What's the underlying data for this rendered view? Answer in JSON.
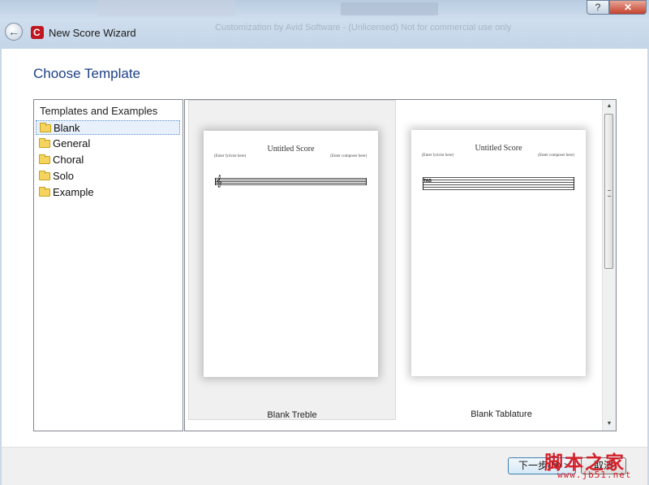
{
  "window": {
    "title": "New Score Wizard",
    "background_text": "Customization by Avid Software - (Unlicensed) Not for commercial use only",
    "help_button": "?",
    "close_button": "✕",
    "back_button": "←",
    "app_icon": "finale-logo-icon",
    "app_icon_glyph": "C"
  },
  "heading": "Choose Template",
  "templates_panel": {
    "title": "Templates and Examples",
    "items": [
      {
        "label": "Blank",
        "selected": true
      },
      {
        "label": "General",
        "selected": false
      },
      {
        "label": "Choral",
        "selected": false
      },
      {
        "label": "Solo",
        "selected": false
      },
      {
        "label": "Example",
        "selected": false
      }
    ]
  },
  "previews": [
    {
      "label": "Blank Treble",
      "selected": true,
      "page": {
        "title": "Untitled Score",
        "lyricist": "(Enter lyricist here)",
        "composer": "(Enter composer here)",
        "clef": "𝄞",
        "clef_type": "treble"
      }
    },
    {
      "label": "Blank Tablature",
      "selected": false,
      "page": {
        "title": "Untitled Score",
        "lyricist": "(Enter lyricist here)",
        "composer": "(Enter composer here)",
        "clef": "TAB",
        "clef_type": "tab"
      }
    }
  ],
  "scrollbar": {
    "up": "▲",
    "down": "▼"
  },
  "footer": {
    "next_label": "下一步(N) >",
    "cancel_label": "取消"
  },
  "watermark": {
    "text_cn": "脚本之家",
    "url": "www.jb51.net",
    "color": "#d4202a"
  },
  "colors": {
    "heading": "#1e3f86",
    "selection_border": "#5b8fcf",
    "close_button": "#c4412f"
  }
}
